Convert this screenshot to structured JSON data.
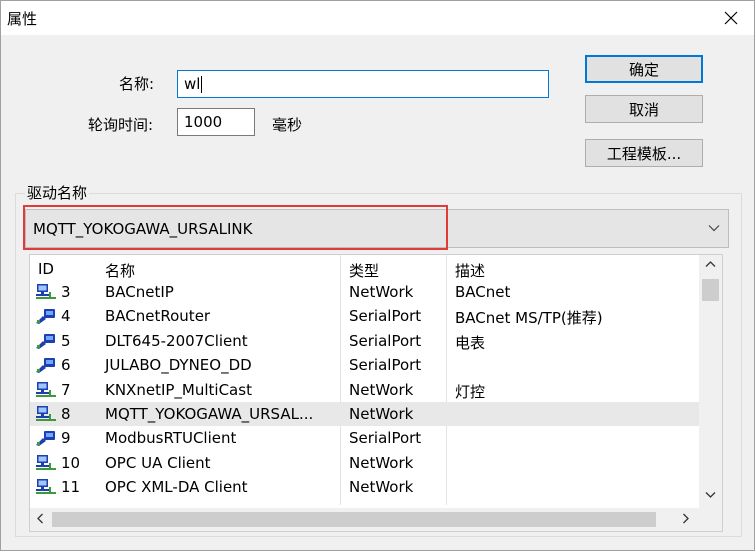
{
  "window": {
    "title": "属性",
    "close_glyph": "✕"
  },
  "form": {
    "name_label": "名称:",
    "name_value": "wl",
    "poll_label": "轮询时间:",
    "poll_value": "1000",
    "poll_unit": "毫秒"
  },
  "buttons": {
    "ok": "确定",
    "cancel": "取消",
    "template": "工程模板..."
  },
  "driver_group": {
    "label": "驱动名称",
    "selected_driver": "MQTT_YOKOGAWA_URSALINK"
  },
  "driver_list": {
    "columns": [
      "ID",
      "名称",
      "类型",
      "描述"
    ],
    "rows": [
      {
        "id": "3",
        "name": "BACnetIP",
        "type": "NetWork",
        "desc": "BACnet",
        "icon": "network-device-icon"
      },
      {
        "id": "4",
        "name": "BACnetRouter",
        "type": "SerialPort",
        "desc": "BACnet MS/TP(推荐)",
        "icon": "serial-device-icon"
      },
      {
        "id": "5",
        "name": "DLT645-2007Client",
        "type": "SerialPort",
        "desc": "电表",
        "icon": "serial-device-icon"
      },
      {
        "id": "6",
        "name": "JULABO_DYNEO_DD",
        "type": "SerialPort",
        "desc": "",
        "icon": "serial-device-icon"
      },
      {
        "id": "7",
        "name": "KNXnetIP_MultiCast",
        "type": "NetWork",
        "desc": "灯控",
        "icon": "network-device-icon"
      },
      {
        "id": "8",
        "name": "MQTT_YOKOGAWA_URSAL...",
        "type": "NetWork",
        "desc": "",
        "icon": "network-device-icon",
        "selected": true
      },
      {
        "id": "9",
        "name": "ModbusRTUClient",
        "type": "SerialPort",
        "desc": "",
        "icon": "serial-device-icon"
      },
      {
        "id": "10",
        "name": "OPC UA Client",
        "type": "NetWork",
        "desc": "",
        "icon": "network-device-icon"
      },
      {
        "id": "11",
        "name": "OPC XML-DA Client",
        "type": "NetWork",
        "desc": "",
        "icon": "network-device-icon"
      }
    ]
  },
  "colors": {
    "accent": "#0078d7",
    "highlight_border": "#e03a3a",
    "icon_blue": "#1f3fb0",
    "icon_green": "#3a9a3a"
  }
}
